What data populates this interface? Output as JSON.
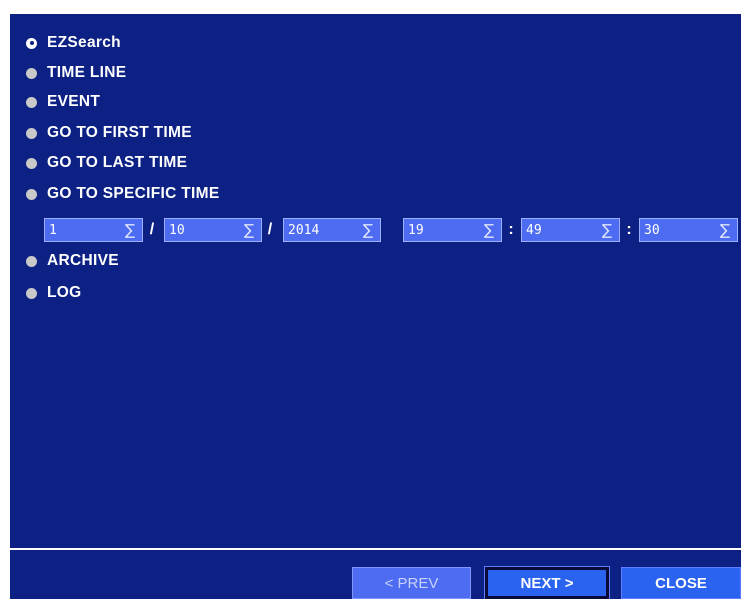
{
  "options": [
    {
      "label": "EZSearch",
      "selected": true
    },
    {
      "label": "TIME LINE",
      "selected": false
    },
    {
      "label": "EVENT",
      "selected": false
    },
    {
      "label": "GO TO FIRST TIME",
      "selected": false
    },
    {
      "label": "GO TO LAST TIME",
      "selected": false
    },
    {
      "label": "GO TO SPECIFIC TIME",
      "selected": false
    },
    {
      "label": "ARCHIVE",
      "selected": false
    },
    {
      "label": "LOG",
      "selected": false
    }
  ],
  "specific_time": {
    "month": "1",
    "day": "10",
    "year": "2014",
    "hour": "19",
    "minute": "49",
    "second": "30",
    "date_separator": "/",
    "time_separator": ":",
    "spin_glyph": "∑"
  },
  "buttons": {
    "prev": "< PREV",
    "next": "NEXT >",
    "close": "CLOSE"
  },
  "colors": {
    "panel_background": "#0c2183",
    "field_background": "#4d6cf2",
    "button_active": "#2a63f0"
  }
}
